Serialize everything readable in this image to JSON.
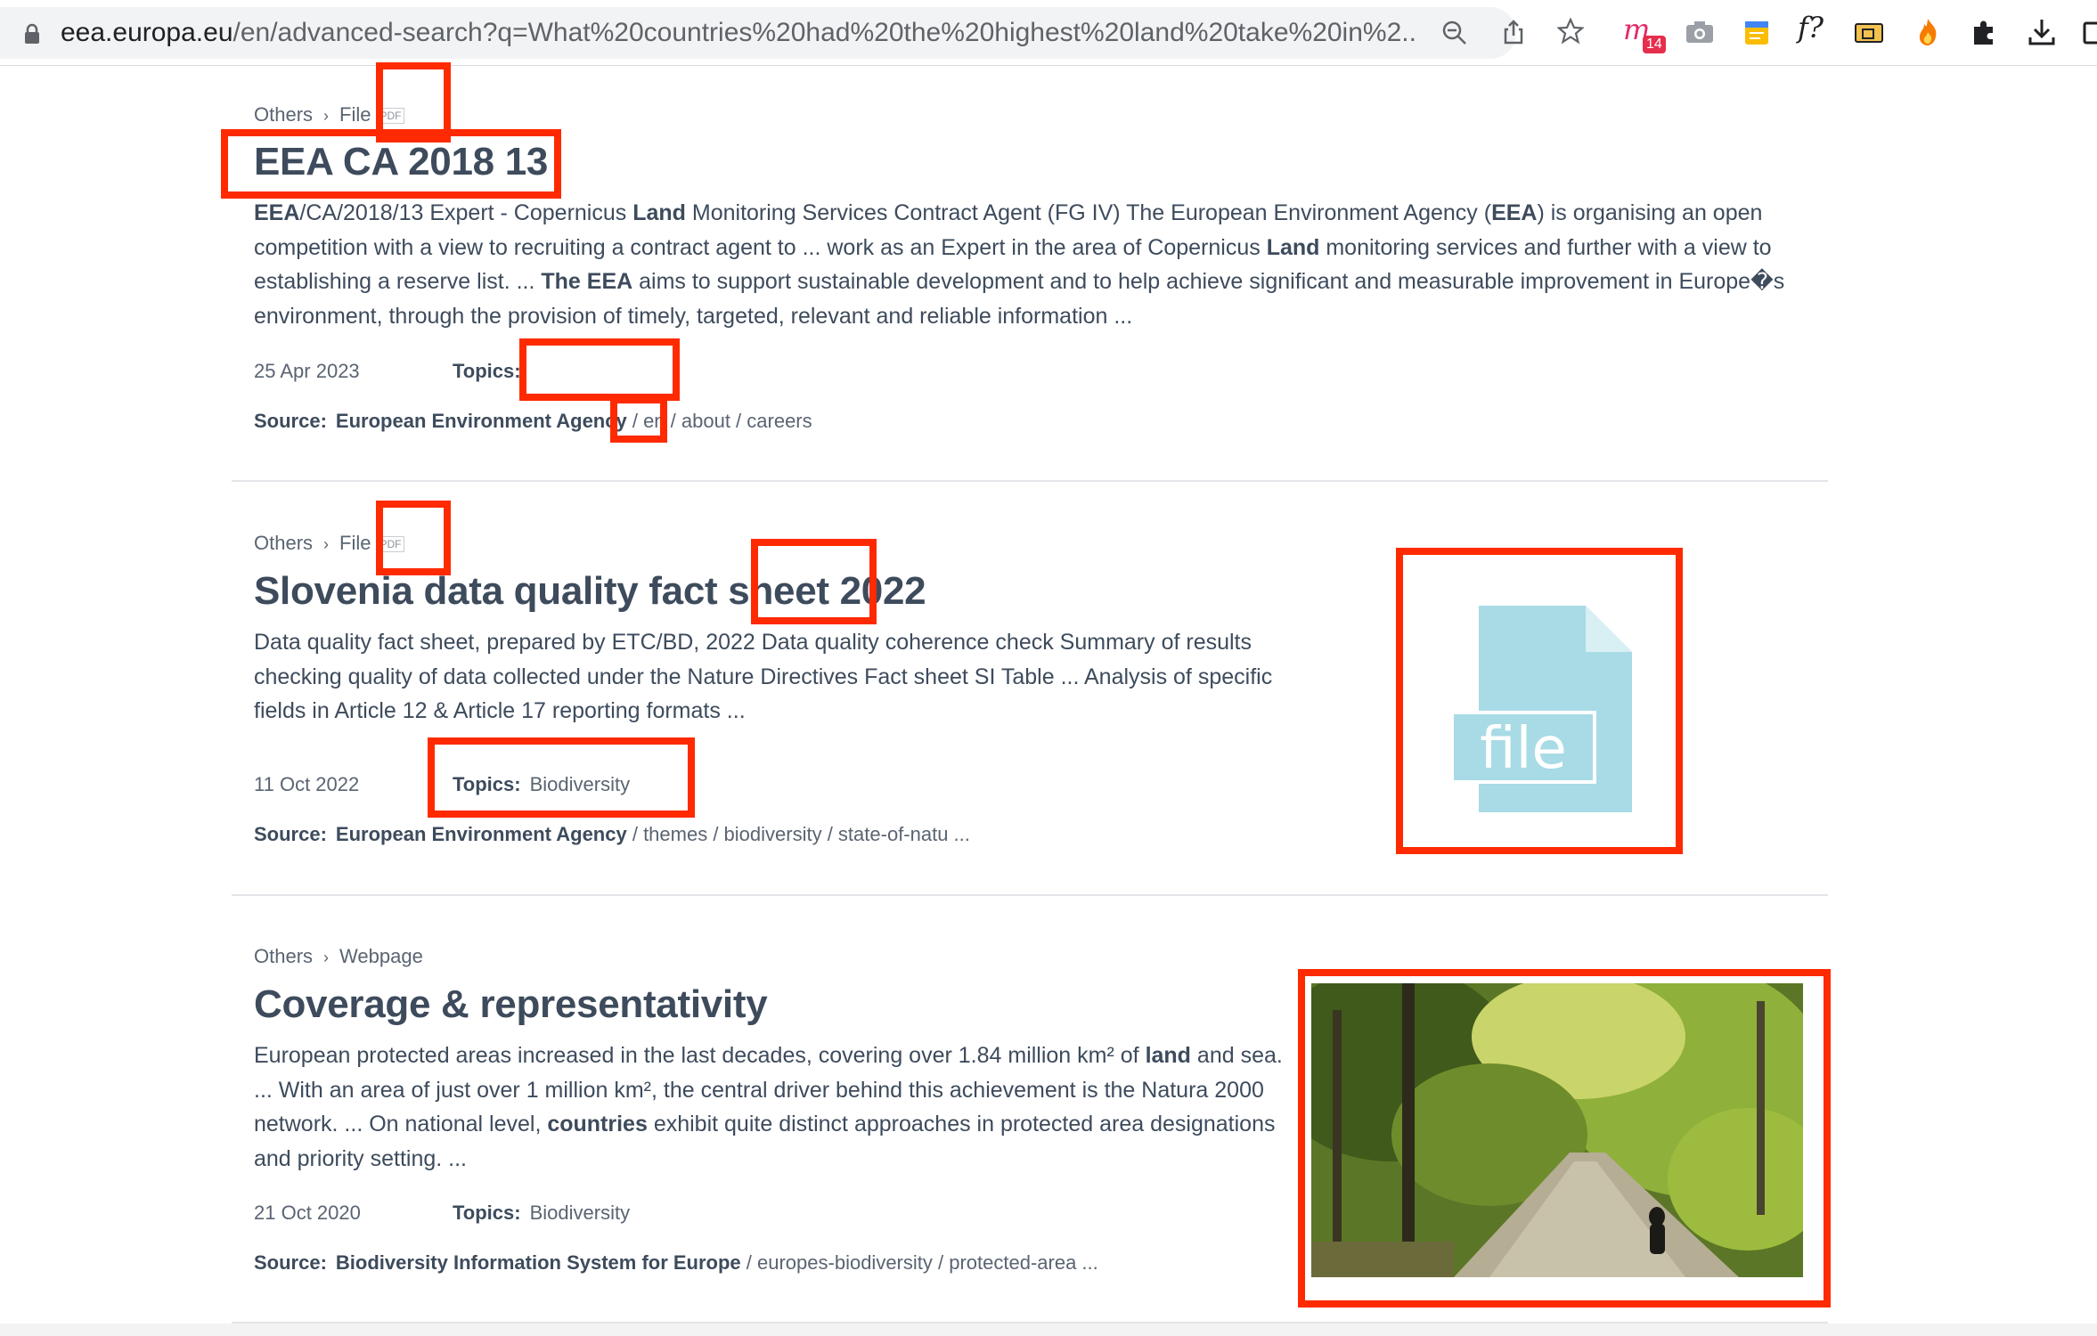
{
  "browser": {
    "url_domain": "eea.europa.eu",
    "url_path": "/en/advanced-search?q=What%20countries%20had%20the%20highest%20land%20take%20in%2...",
    "extension_badge": "14",
    "fx_label": "f?",
    "icons": [
      "lock-icon",
      "zoom-out-icon",
      "share-icon",
      "bookmark-star-icon",
      "mendeley-icon",
      "camera-icon",
      "notes-icon",
      "formula-icon",
      "folder-icon",
      "flame-icon",
      "extensions-puzzle-icon",
      "download-icon"
    ]
  },
  "results": [
    {
      "crumb_1": "Others",
      "crumb_2": "File",
      "file_tag": "PDF",
      "title": "EEA CA 2018 13",
      "snippet_html": "<b>EEA</b>/CA/2018/13 Expert - Copernicus <b>Land</b> Monitoring Services Contract Agent (FG IV) The European Environment Agency (<b>EEA</b>) is organising an open competition with a view to recruiting a contract agent to ... work as an Expert in the area of Copernicus <b>Land</b> monitoring services and further with a view to establishing a reserve list. ... <b>The EEA</b> aims to support sustainable development and to help achieve significant and measurable improvement in Europe�s environment, through the provision of timely, targeted, relevant and reliable information ...",
      "date": "25 Apr 2023",
      "topics_label": "Topics:",
      "topics_value": "",
      "source_label": "Source:",
      "source_org": "European Environment Agency",
      "source_path": " / en / about / careers"
    },
    {
      "crumb_1": "Others",
      "crumb_2": "File",
      "file_tag": "PDF",
      "title": "Slovenia data quality fact sheet 2022",
      "snippet_html": "Data quality fact sheet, prepared by ETC/BD, 2022 Data quality coherence check Summary of results checking quality of data collected under the Nature Directives Fact sheet SI Table ... Analysis of specific fields in Article 12 &amp; Article 17 reporting formats ...",
      "date": "11 Oct 2022",
      "topics_label": "Topics:",
      "topics_value": "Biodiversity",
      "source_label": "Source:",
      "source_org": "European Environment Agency",
      "source_path": " / themes / biodiversity / state-of-natu ...",
      "thumb_text": "file"
    },
    {
      "crumb_1": "Others",
      "crumb_2": "Webpage",
      "title": "Coverage & representativity",
      "snippet_html": "European protected areas increased in the last decades, covering over 1.84 million km² of <b>land</b> and sea. ... With an area of just over 1 million km², the central driver behind this achievement is the Natura 2000 network. ... On national level, <b>countries</b> exhibit quite distinct approaches in protected area designations and priority setting. ...",
      "date": "21 Oct 2020",
      "topics_label": "Topics:",
      "topics_value": "Biodiversity",
      "source_label": "Source:",
      "source_org": "Biodiversity Information System for Europe",
      "source_path": " / europes-biodiversity / protected-area ..."
    }
  ],
  "colors": {
    "highlight": "#ff2a00",
    "text": "#3d4b5c",
    "file_thumb": "#a8dbe5"
  }
}
